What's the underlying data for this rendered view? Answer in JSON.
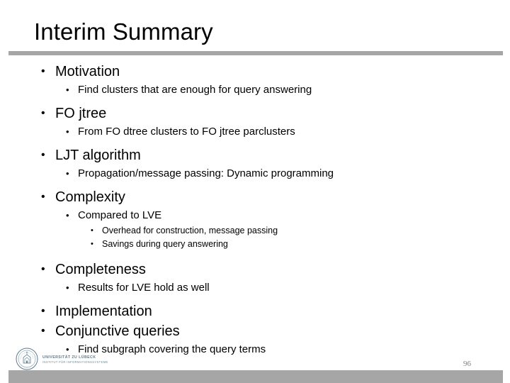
{
  "slide": {
    "title": "Interim Summary",
    "page_number": "96",
    "accent_gray": "#a6a6a6",
    "background": "#ffffff",
    "text_color": "#000000",
    "bullet_glyph": "•"
  },
  "outline": [
    {
      "level": 1,
      "text": "Motivation"
    },
    {
      "level": 2,
      "text": "Find clusters that are enough for query answering"
    },
    {
      "level": 1,
      "text": "FO jtree"
    },
    {
      "level": 2,
      "text": "From FO dtree clusters to FO jtree parclusters"
    },
    {
      "level": 1,
      "text": "LJT algorithm"
    },
    {
      "level": 2,
      "text": "Propagation/message passing: Dynamic programming"
    },
    {
      "level": 1,
      "text": "Complexity"
    },
    {
      "level": 2,
      "text": "Compared to LVE"
    },
    {
      "level": 3,
      "text": "Overhead for construction, message passing"
    },
    {
      "level": 3,
      "text": "Savings during query answering"
    },
    {
      "level": 1,
      "text": "Completeness"
    },
    {
      "level": 2,
      "text": "Results for LVE hold as well"
    },
    {
      "level": 1,
      "text": "Implementation"
    },
    {
      "level": 1,
      "text": "Conjunctive queries"
    },
    {
      "level": 2,
      "text": "Find subgraph covering the query terms"
    }
  ],
  "footer": {
    "logo": {
      "seal_name": "university-seal-icon",
      "line1": "UNIVERSITÄT ZU LÜBECK",
      "line2": "INSTITUT FÜR INFORMATIONSSYSTEME",
      "color": "#5b7c8d"
    }
  }
}
